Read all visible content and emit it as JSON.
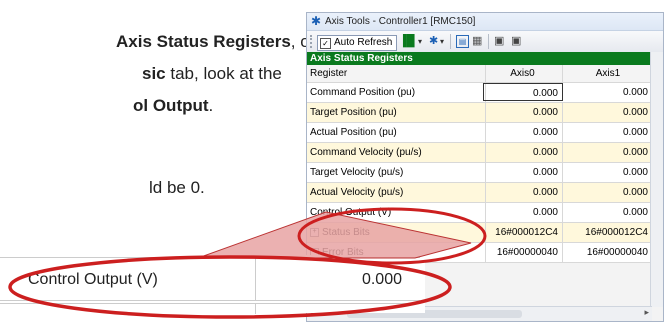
{
  "doc": {
    "line1_bold": "Axis Status Registers",
    "line1_rest": ", on",
    "line2_bold": "sic",
    "line2_rest": " tab, look at the",
    "line3_bold": "ol Output",
    "line3_rest": ".",
    "line4": "ld be 0."
  },
  "window": {
    "title": "Axis Tools - Controller1 [RMC150]",
    "toolbar": {
      "auto_refresh_label": "Auto Refresh",
      "auto_refresh_checked": "✓"
    },
    "section_title": "Axis Status Registers",
    "columns": [
      "Register",
      "Axis0",
      "Axis1"
    ],
    "rows": [
      {
        "register": "Command Position (pu)",
        "axis0": "0.000",
        "axis1": "0.000"
      },
      {
        "register": "Target Position (pu)",
        "axis0": "0.000",
        "axis1": "0.000"
      },
      {
        "register": "Actual Position (pu)",
        "axis0": "0.000",
        "axis1": "0.000"
      },
      {
        "register": "Command Velocity (pu/s)",
        "axis0": "0.000",
        "axis1": "0.000"
      },
      {
        "register": "Target Velocity (pu/s)",
        "axis0": "0.000",
        "axis1": "0.000"
      },
      {
        "register": "Actual Velocity (pu/s)",
        "axis0": "0.000",
        "axis1": "0.000"
      },
      {
        "register": "Control Output (V)",
        "axis0": "0.000",
        "axis1": "0.000"
      },
      {
        "register": "Status Bits",
        "axis0": "16#000012C4",
        "axis1": "16#000012C4"
      },
      {
        "register": "Error Bits",
        "axis0": "16#00000040",
        "axis1": "16#00000040"
      }
    ]
  },
  "zoom": {
    "label": "Control Output (V)",
    "value": "0.000"
  },
  "colors": {
    "section_header": "#0a7a1e",
    "highlight_ellipse": "#cc1f1f",
    "callout_fill": "#e8a3a3",
    "yellow_row": "#fff8dc"
  }
}
